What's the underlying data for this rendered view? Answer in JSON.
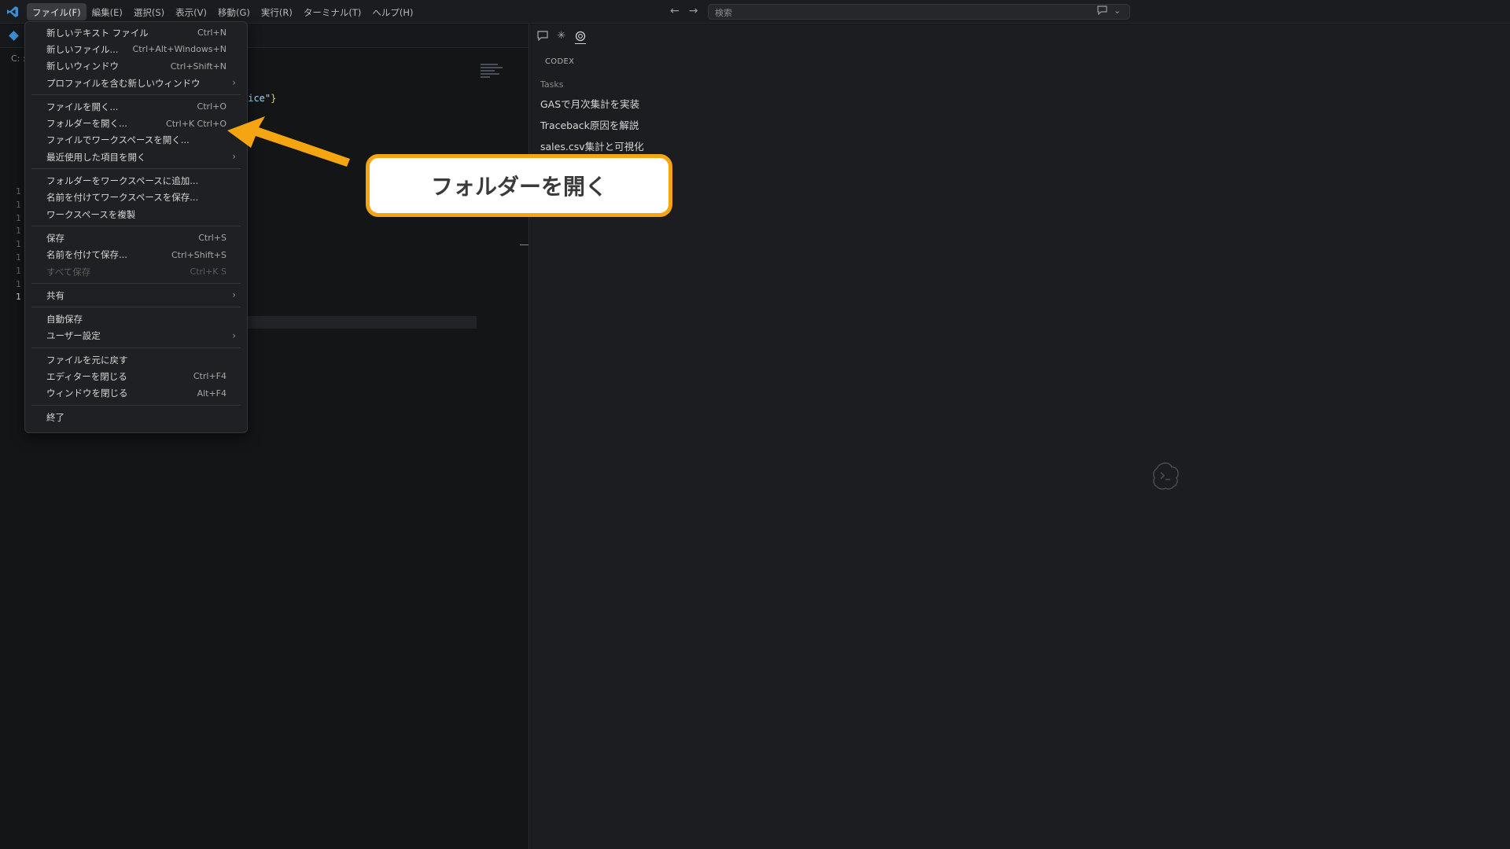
{
  "menubar": [
    "ファイル(F)",
    "編集(E)",
    "選択(S)",
    "表示(V)",
    "移動(G)",
    "実行(R)",
    "ターミナル(T)",
    "ヘルプ(H)"
  ],
  "search": {
    "placeholder": "検索"
  },
  "editor": {
    "breadcrumb": "C: :",
    "code_fragment": "lice\"",
    "code_brace": "}",
    "line_numbers": [
      "1",
      "1",
      "1",
      "1",
      "1",
      "1",
      "1",
      "1",
      "1"
    ]
  },
  "file_menu": {
    "groups": [
      [
        {
          "label": "新しいテキスト ファイル",
          "shortcut": "Ctrl+N"
        },
        {
          "label": "新しいファイル...",
          "shortcut": "Ctrl+Alt+Windows+N"
        },
        {
          "label": "新しいウィンドウ",
          "shortcut": "Ctrl+Shift+N"
        },
        {
          "label": "プロファイルを含む新しいウィンドウ",
          "shortcut": "",
          "submenu": true
        }
      ],
      [
        {
          "label": "ファイルを開く...",
          "shortcut": "Ctrl+O"
        },
        {
          "label": "フォルダーを開く...",
          "shortcut": "Ctrl+K Ctrl+O"
        },
        {
          "label": "ファイルでワークスペースを開く...",
          "shortcut": ""
        },
        {
          "label": "最近使用した項目を開く",
          "shortcut": "",
          "submenu": true
        }
      ],
      [
        {
          "label": "フォルダーをワークスペースに追加...",
          "shortcut": ""
        },
        {
          "label": "名前を付けてワークスペースを保存...",
          "shortcut": ""
        },
        {
          "label": "ワークスペースを複製",
          "shortcut": ""
        }
      ],
      [
        {
          "label": "保存",
          "shortcut": "Ctrl+S"
        },
        {
          "label": "名前を付けて保存...",
          "shortcut": "Ctrl+Shift+S"
        },
        {
          "label": "すべて保存",
          "shortcut": "Ctrl+K S",
          "disabled": true
        }
      ],
      [
        {
          "label": "共有",
          "shortcut": "",
          "submenu": true
        }
      ],
      [
        {
          "label": "自動保存",
          "shortcut": ""
        },
        {
          "label": "ユーザー設定",
          "shortcut": "",
          "submenu": true
        }
      ],
      [
        {
          "label": "ファイルを元に戻す",
          "shortcut": ""
        },
        {
          "label": "エディターを閉じる",
          "shortcut": "Ctrl+F4"
        },
        {
          "label": "ウィンドウを閉じる",
          "shortcut": "Alt+F4"
        }
      ],
      [
        {
          "label": "終了",
          "shortcut": ""
        }
      ]
    ]
  },
  "panel": {
    "title": "CODEX",
    "tasks_label": "Tasks",
    "tasks": [
      "GASで月次集計を実装",
      "Traceback原因を解説",
      "sales.csv集計と可視化"
    ]
  },
  "callout": {
    "text": "フォルダーを開く"
  },
  "colors": {
    "accent": "#f5a512",
    "vscode_blue": "#3b8fd6"
  }
}
